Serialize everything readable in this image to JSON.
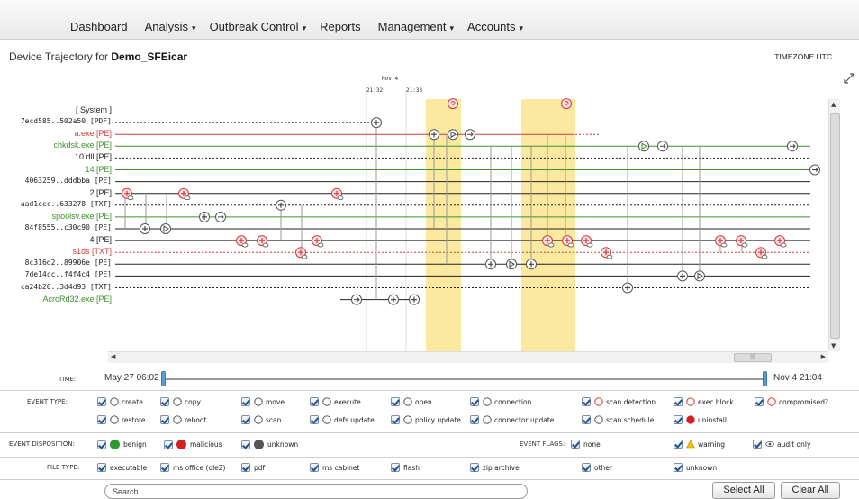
{
  "nav": {
    "items": [
      {
        "label": "Dashboard",
        "caret": ""
      },
      {
        "label": "Analysis",
        "caret": "▾"
      },
      {
        "label": "Outbreak Control",
        "caret": "▾"
      },
      {
        "label": "Reports",
        "caret": ""
      },
      {
        "label": "Management",
        "caret": "▾"
      },
      {
        "label": "Accounts",
        "caret": "▾"
      }
    ]
  },
  "header": {
    "title_prefix": "Device Trajectory for ",
    "device": "Demo_SFEicar",
    "timezone": "TIMEZONE UTC",
    "time_header": {
      "date": "Nov 4",
      "t1": "21:32",
      "t2": "21:33"
    }
  },
  "trajectory": {
    "rows": [
      {
        "label": "[ System ]",
        "color": "#222222",
        "style": "none",
        "big": true
      },
      {
        "label": "7ecd585..502a50 [PDF]",
        "color": "#222222",
        "style": "dotted",
        "big": false
      },
      {
        "label": "a.exe [PE]",
        "color": "#d13b3b",
        "style": "solid",
        "big": true
      },
      {
        "label": "chkdsk.exe [PE]",
        "color": "#3f8f2c",
        "style": "solid",
        "big": true
      },
      {
        "label": "10.dll [PE]",
        "color": "#222222",
        "style": "dotted",
        "big": true
      },
      {
        "label": "14 [PE]",
        "color": "#3f8f2c",
        "style": "solid",
        "big": true
      },
      {
        "label": "4063259..dddbba [PE]",
        "color": "#222222",
        "style": "solid",
        "big": false
      },
      {
        "label": "2 [PE]",
        "color": "#222222",
        "style": "solid",
        "big": true
      },
      {
        "label": "aad1ccc..633278 [TXT]",
        "color": "#222222",
        "style": "dotted",
        "big": false
      },
      {
        "label": "spoolsv.exe [PE]",
        "color": "#3f8f2c",
        "style": "solid",
        "big": true
      },
      {
        "label": "84f8555..c30c90 [PE]",
        "color": "#222222",
        "style": "solid",
        "big": false
      },
      {
        "label": "4 [PE]",
        "color": "#222222",
        "style": "solid",
        "big": true
      },
      {
        "label": "s1ds [TXT]",
        "color": "#d13b3b",
        "style": "dotted",
        "big": true
      },
      {
        "label": "8c316d2..89906e [PE]",
        "color": "#222222",
        "style": "solid",
        "big": false
      },
      {
        "label": "7de14cc..f4f4c4 [PE]",
        "color": "#222222",
        "style": "solid",
        "big": false
      },
      {
        "label": "ca24b20..3d4d93 [TXT]",
        "color": "#222222",
        "style": "dotted",
        "big": false
      },
      {
        "label": "AcroRd32.exe [PE]",
        "color": "#3f8f2c",
        "style": "none",
        "big": true
      }
    ],
    "icon_names": [
      "create-icon",
      "move-icon",
      "execute-icon",
      "scan-detection-icon",
      "compromised-icon"
    ]
  },
  "timeline": {
    "label": "TIME:",
    "start": "May 27 06:02",
    "end": "Nov 4 21:04"
  },
  "filters": {
    "event_type_label": "EVENT TYPE:",
    "event_types": [
      {
        "label": "create",
        "icon": "create-icon"
      },
      {
        "label": "copy",
        "icon": "copy-icon"
      },
      {
        "label": "move",
        "icon": "move-icon"
      },
      {
        "label": "execute",
        "icon": "execute-icon"
      },
      {
        "label": "open",
        "icon": "open-icon"
      },
      {
        "label": "connection",
        "icon": "connection-icon"
      },
      {
        "label": "scan detection",
        "icon": "scan-detection-icon"
      },
      {
        "label": "exec block",
        "icon": "exec-block-icon"
      },
      {
        "label": "compromised?",
        "icon": "compromised-icon"
      },
      {
        "label": "restore",
        "icon": "restore-icon"
      },
      {
        "label": "reboot",
        "icon": "reboot-icon"
      },
      {
        "label": "scan",
        "icon": "scan-icon"
      },
      {
        "label": "defs update",
        "icon": "defs-update-icon"
      },
      {
        "label": "policy update",
        "icon": "policy-update-icon"
      },
      {
        "label": "connector update",
        "icon": "connector-update-icon"
      },
      {
        "label": "scan schedule",
        "icon": "scan-schedule-icon"
      },
      {
        "label": "uninstall",
        "icon": "uninstall-icon"
      }
    ],
    "disposition_label": "EVENT DISPOSITION:",
    "dispositions": [
      {
        "label": "benign",
        "color": "#2e9a2e"
      },
      {
        "label": "malicious",
        "color": "#d42020"
      },
      {
        "label": "unknown",
        "color": "#555555"
      }
    ],
    "flags_label": "EVENT FLAGS:",
    "flags": [
      {
        "label": "none",
        "icon": ""
      },
      {
        "label": "warning",
        "icon": "warning-icon"
      },
      {
        "label": "audit only",
        "icon": "eye-icon"
      }
    ],
    "file_type_label": "FILE TYPE:",
    "file_types": [
      "executable",
      "ms office (ole2)",
      "pdf",
      "ms cabinet",
      "flash",
      "zip archive",
      "other",
      "unknown"
    ]
  },
  "search": {
    "value": "Search..."
  },
  "buttons": {
    "select_all": "Select All",
    "clear_all": "Clear All"
  },
  "colors": {
    "highlight": "#fbe9a0",
    "malicious": "#d13b3b",
    "benign": "#3f8f2c"
  }
}
